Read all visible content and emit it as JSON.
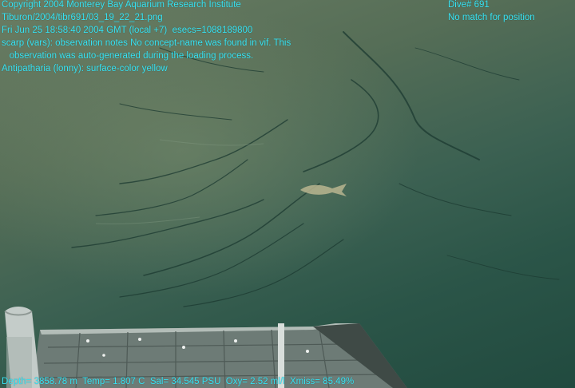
{
  "overlay": {
    "copyright": "Copyright 2004 Monterey Bay Aquarium Research Institute",
    "file_path": "Tiburon/2004/tibr691/03_19_22_21.png",
    "timestamp": "Fri Jun 25 18:58:40 2004 GMT (local +7)  esecs=1088189800",
    "observation_line1": "scarp (vars): observation notes No concept-name was found in vif. This",
    "observation_line2": "   observation was auto-generated during the loading process.",
    "annotation": "Antipatharia (lonny): surface-color yellow",
    "dive_number": "Dive# 691",
    "position_status": "No match for position",
    "telemetry": "Depth= 3858.78 m  Temp= 1.807 C  Sal= 34.545 PSU  Oxy= 2.52 ml/l  Xmiss= 85.49%"
  },
  "colors": {
    "overlay_text": "#38e4f4",
    "seafloor_light": "#6a7d63",
    "seafloor_dark": "#214a3f"
  }
}
